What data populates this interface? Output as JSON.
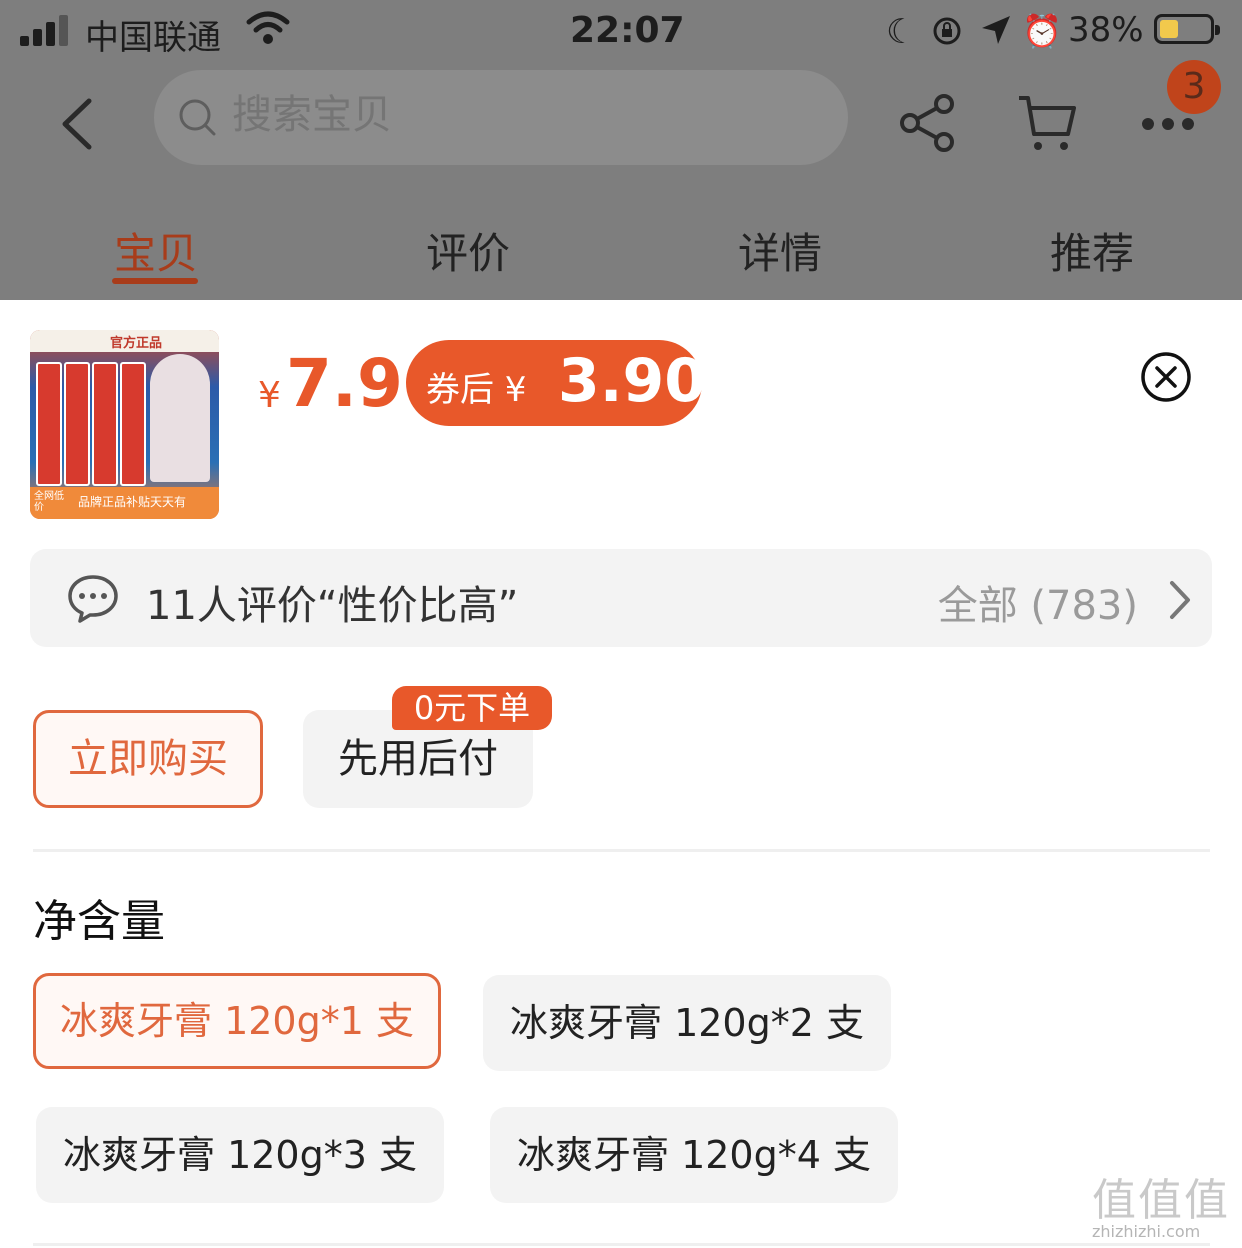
{
  "status_bar": {
    "carrier": "中国联通",
    "time": "22:07",
    "battery_pct": "38%",
    "battery_level": 0.38,
    "icons": [
      "signal-icon",
      "wifi-icon",
      "moon-icon",
      "rotation-lock-icon",
      "location-icon",
      "alarm-icon",
      "battery-icon"
    ]
  },
  "nav": {
    "search_placeholder": "搜索宝贝",
    "cart_badge": "3",
    "icons": [
      "back-icon",
      "search-icon",
      "share-icon",
      "cart-icon",
      "more-icon"
    ]
  },
  "tabs": [
    {
      "label": "宝贝",
      "active": true
    },
    {
      "label": "评价",
      "active": false
    },
    {
      "label": "详情",
      "active": false
    },
    {
      "label": "推荐",
      "active": false
    }
  ],
  "product": {
    "thumb_label": "官方正品",
    "thumb_footer": "品牌正品补贴天天有",
    "thumb_corner": "全网低价",
    "currency": "¥",
    "price": "7.9",
    "coupon_label": "券后 ¥",
    "coupon_price": "3.90"
  },
  "review_bar": {
    "text": "11人评价“性价比高”",
    "all_label": "全部 (783)"
  },
  "actions": {
    "buy_now": "立即购买",
    "pay_later": "先用后付",
    "pay_later_tag": "0元下单"
  },
  "spec": {
    "title": "净含量",
    "options": [
      {
        "label": "冰爽牙膏 120g*1 支",
        "selected": true
      },
      {
        "label": "冰爽牙膏 120g*2 支",
        "selected": false
      },
      {
        "label": "冰爽牙膏 120g*3 支",
        "selected": false
      },
      {
        "label": "冰爽牙膏 120g*4 支",
        "selected": false
      }
    ]
  },
  "watermark": {
    "main": "值值值",
    "sub": "zhizhizhi.com"
  },
  "colors": {
    "accent": "#e8582a",
    "overlay": "#7e7e7e",
    "chip_bg": "#f3f3f3"
  }
}
